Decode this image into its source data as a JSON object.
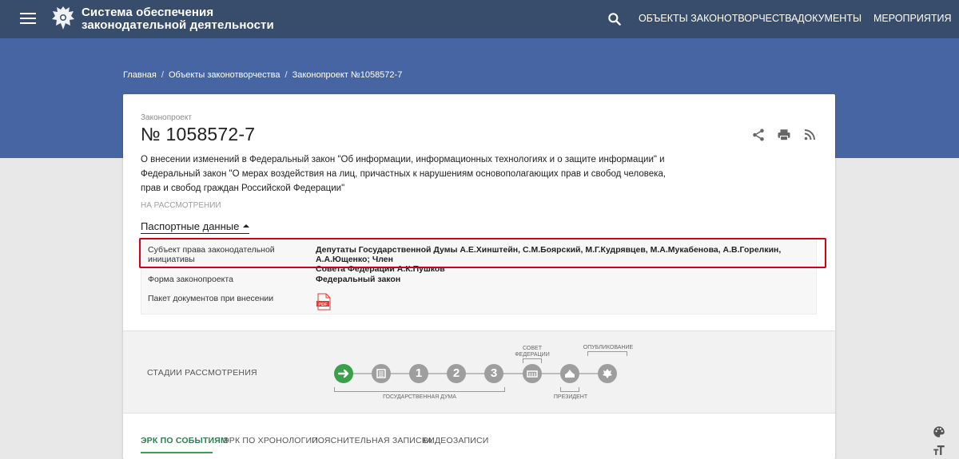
{
  "header": {
    "title_line1": "Система обеспечения",
    "title_line2": "законодательной деятельности",
    "nav": [
      "ОБЪЕКТЫ ЗАКОНОТВОРЧЕСТВА",
      "ДОКУМЕНТЫ",
      "МЕРОПРИЯТИЯ"
    ]
  },
  "breadcrumbs": [
    "Главная",
    "Объекты законотворчества",
    "Законопроект №1058572-7"
  ],
  "bill": {
    "kind": "Законопроект",
    "number": "№ 1058572-7",
    "description_lines": [
      "О внесении изменений в Федеральный закон \"Об информации, информационных технологиях и о защите информации\" и",
      "Федеральный закон \"О мерах воздействия на лиц, причастных к нарушениям основополагающих прав и свобод человека,",
      "прав и свобод граждан Российской Федерации\""
    ],
    "status": "НА РАССМОТРЕНИИ"
  },
  "passport": {
    "toggle_label": "Паспортные данные",
    "rows": [
      {
        "label_lines": [
          "Субъект права законодательной",
          "инициативы"
        ],
        "value_lines": [
          "Депутаты Государственной Думы А.Е.Хинштейн, С.М.Боярский, М.Г.Кудрявцев, М.А.Мукабенова, А.В.Горелкин, А.А.Ющенко; Член",
          "Совета Федерации А.К.Пушков"
        ]
      },
      {
        "label": "Форма законопроекта",
        "value": "Федеральный закон"
      },
      {
        "label": "Пакет документов при внесении",
        "value_icon": "pdf-icon"
      }
    ]
  },
  "stages": {
    "title": "СТАДИИ РАССМОТРЕНИЯ",
    "numbers": [
      "1",
      "2",
      "3"
    ],
    "label_duma": "ГОСУДАРСТВЕННАЯ ДУМА",
    "label_council_1": "СОВЕТ",
    "label_council_2": "ФЕДЕРАЦИИ",
    "label_president": "ПРЕЗИДЕНТ",
    "label_publication": "ОПУБЛИКОВАНИЕ"
  },
  "tabs": [
    "ЭРК ПО СОБЫТИЯМ",
    "ЭРК ПО ХРОНОЛОГИИ",
    "ПОЯСНИТЕЛЬНАЯ ЗАПИСКА",
    "ВИДЕОЗАПИСИ"
  ],
  "colors": {
    "topbar": "#384c6c",
    "hero": "#4665a2",
    "accent_green": "#3aa04a",
    "highlight_red": "#d0021b",
    "stage_gray": "#9e9e9e"
  }
}
